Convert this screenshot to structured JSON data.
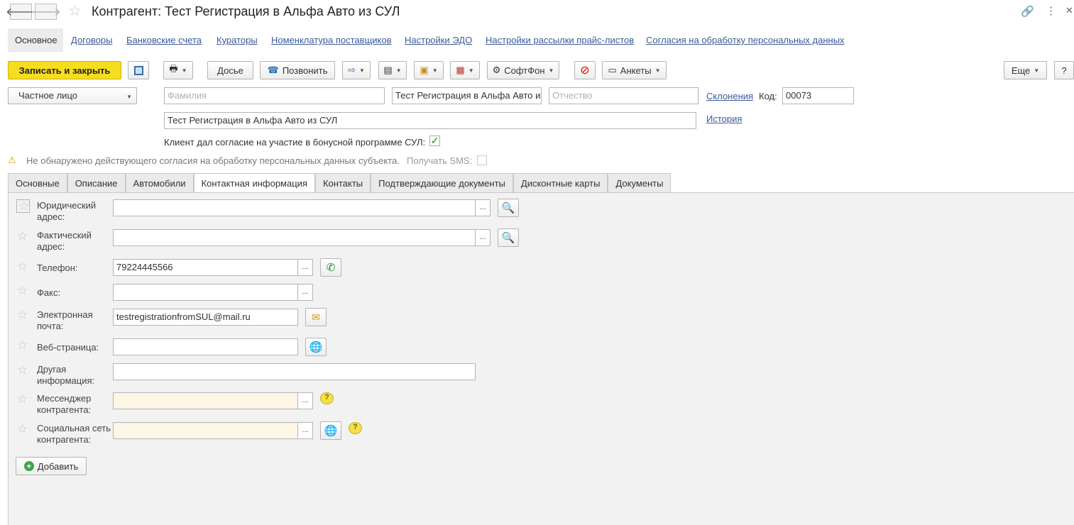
{
  "window": {
    "title": "Контрагент: Тест Регистрация в Альфа Авто из СУЛ"
  },
  "top_links": [
    "Основное",
    "Договоры",
    "Банковские счета",
    "Кураторы",
    "Номенклатура поставщиков",
    "Настройки ЭДО",
    "Настройки рассылки прайс-листов",
    "Согласия на обработку персональных данных"
  ],
  "toolbar": {
    "save_close": "Записать и закрыть",
    "dossier": "Досье",
    "call": "Позвонить",
    "softphone": "СофтФон",
    "surveys": "Анкеты",
    "more": "Еще",
    "help": "?"
  },
  "header_form": {
    "person_type": "Частное лицо",
    "surname_placeholder": "Фамилия",
    "name_value": "Тест Регистрация в Альфа Авто из СУЛ",
    "patronymic_placeholder": "Отчество",
    "declensions_link": "Склонения",
    "code_label": "Код:",
    "code_value": "00073",
    "full_name": "Тест Регистрация в Альфа Авто из СУЛ",
    "history_link": "История",
    "bonus_consent_label": "Клиент дал согласие на участие в бонусной программе СУЛ:",
    "bonus_consent_checked": true
  },
  "warning": {
    "text": "Не обнаружено действующего согласия на обработку персональных данных субъекта.",
    "sms_label": "Получать SMS:"
  },
  "tabs": [
    "Основные",
    "Описание",
    "Автомобили",
    "Контактная информация",
    "Контакты",
    "Подтверждающие документы",
    "Дисконтные карты",
    "Документы"
  ],
  "active_tab": "Контактная информация",
  "contacts": [
    {
      "label": "Юридический адрес:",
      "value": ""
    },
    {
      "label": "Фактический адрес:",
      "value": ""
    },
    {
      "label": "Телефон:",
      "value": "79224445566"
    },
    {
      "label": "Факс:",
      "value": ""
    },
    {
      "label": "Электронная почта:",
      "value": "testregistrationfromSUL@mail.ru"
    },
    {
      "label": "Веб-страница:",
      "value": ""
    },
    {
      "label": "Другая информация:",
      "value": ""
    },
    {
      "label": "Мессенджер контрагента:",
      "value": ""
    },
    {
      "label": "Социальная сеть контрагента:",
      "value": ""
    }
  ],
  "add_button": "Добавить"
}
